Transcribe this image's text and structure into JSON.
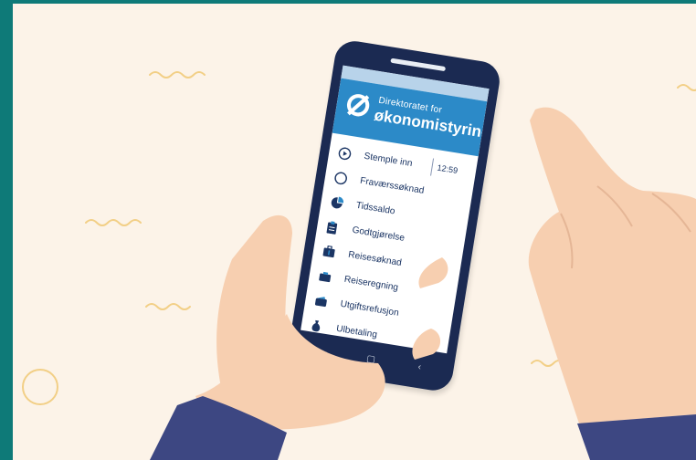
{
  "app": {
    "org_line1": "Direktoratet for",
    "org_line2": "økonomistyring",
    "logo_icon": "circle-slash-logo",
    "time": "12:59"
  },
  "colors": {
    "teal_frame": "#0e7a78",
    "background": "#fcf3e8",
    "phone_body": "#1b2a52",
    "header_blue": "#2c8ac8",
    "menu_text": "#1b3564",
    "skin": "#f7cfb0",
    "sleeve": "#3d4782"
  },
  "menu": [
    {
      "label": "Stemple inn",
      "icon": "play-circle-icon"
    },
    {
      "label": "Fraværssøknad",
      "icon": "circle-icon"
    },
    {
      "label": "Tidssaldo",
      "icon": "pie-chart-icon"
    },
    {
      "label": "Godtgjørelse",
      "icon": "clipboard-icon"
    },
    {
      "label": "Reisesøknad",
      "icon": "suitcase-icon"
    },
    {
      "label": "Reiseregning",
      "icon": "briefcase-icon"
    },
    {
      "label": "Utgiftsrefusjon",
      "icon": "wallet-icon"
    },
    {
      "label": "Ulbetaling",
      "icon": "money-bag-icon"
    }
  ],
  "navbar": [
    {
      "label": "—",
      "icon": "menu-nav-icon"
    },
    {
      "label": "▢",
      "icon": "home-nav-icon"
    },
    {
      "label": "‹",
      "icon": "back-nav-icon"
    }
  ]
}
